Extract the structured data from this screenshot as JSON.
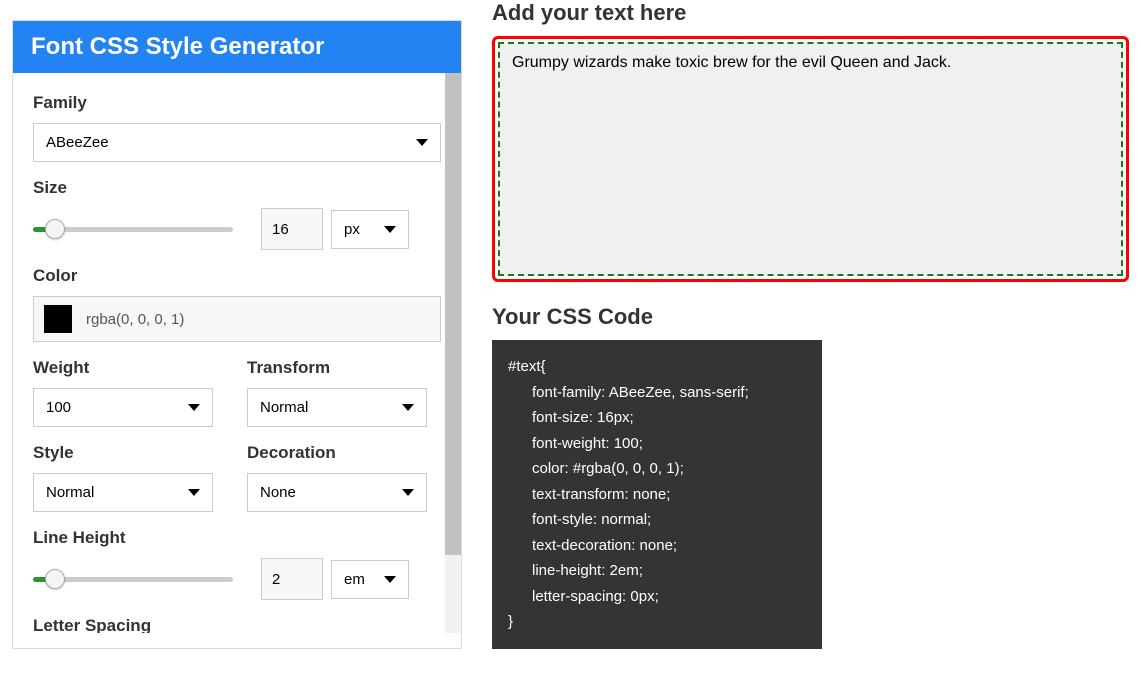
{
  "panel": {
    "title": "Font CSS Style Generator",
    "family": {
      "label": "Family",
      "value": "ABeeZee"
    },
    "size": {
      "label": "Size",
      "value": "16",
      "unit": "px"
    },
    "color": {
      "label": "Color",
      "value": "rgba(0, 0, 0, 1)"
    },
    "weight": {
      "label": "Weight",
      "value": "100"
    },
    "transform": {
      "label": "Transform",
      "value": "Normal"
    },
    "style": {
      "label": "Style",
      "value": "Normal"
    },
    "decoration": {
      "label": "Decoration",
      "value": "None"
    },
    "lineheight": {
      "label": "Line Height",
      "value": "2",
      "unit": "em"
    },
    "letterspacing": {
      "label": "Letter Spacing"
    }
  },
  "preview": {
    "heading": "Add your text here",
    "text": "Grumpy wizards make toxic brew for the evil Queen and Jack."
  },
  "css": {
    "heading": "Your CSS Code",
    "lines": [
      "#text{",
      "font-family: ABeeZee, sans-serif;",
      "font-size: 16px;",
      "font-weight: 100;",
      "color: #rgba(0, 0, 0, 1);",
      "text-transform: none;",
      "font-style: normal;",
      "text-decoration: none;",
      "line-height: 2em;",
      "letter-spacing: 0px;",
      "}"
    ]
  }
}
